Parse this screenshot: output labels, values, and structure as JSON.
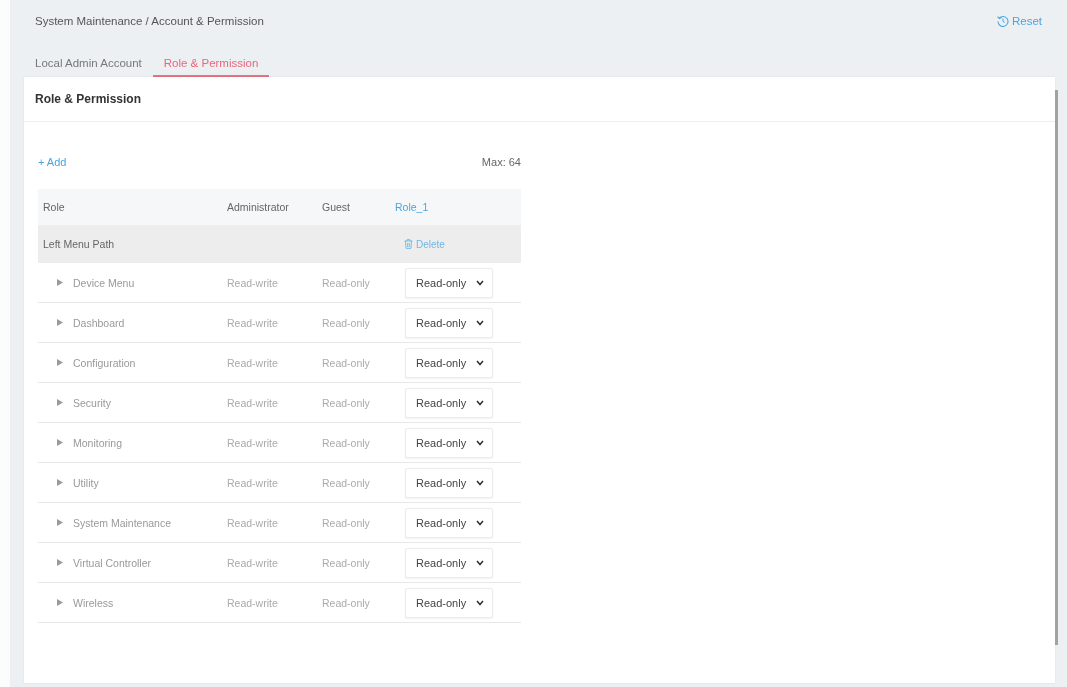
{
  "breadcrumb": "System Maintenance / Account & Permission",
  "reset_button": {
    "label": "Reset"
  },
  "tabs": [
    {
      "label": "Local Admin Account",
      "selected": false
    },
    {
      "label": "Role & Permission",
      "selected": true
    }
  ],
  "card": {
    "title": "Role & Permission",
    "add_button": "+ Add",
    "max_label": "Max: 64"
  },
  "table": {
    "columns": [
      {
        "label": "Role",
        "kind": "text"
      },
      {
        "label": "Administrator",
        "kind": "text"
      },
      {
        "label": "Guest",
        "kind": "text"
      },
      {
        "label": "Role_1",
        "kind": "link"
      }
    ],
    "section_row": {
      "label": "Left Menu Path",
      "delete_button": "Delete"
    },
    "rows": [
      {
        "label": "Device Menu",
        "expanded": false,
        "administrator": "Read-write",
        "guest": "Read-only",
        "role_1": "Read-only"
      },
      {
        "label": "Dashboard",
        "expanded": false,
        "administrator": "Read-write",
        "guest": "Read-only",
        "role_1": "Read-only"
      },
      {
        "label": "Configuration",
        "expanded": false,
        "administrator": "Read-write",
        "guest": "Read-only",
        "role_1": "Read-only"
      },
      {
        "label": "Security",
        "expanded": false,
        "administrator": "Read-write",
        "guest": "Read-only",
        "role_1": "Read-only"
      },
      {
        "label": "Monitoring",
        "expanded": false,
        "administrator": "Read-write",
        "guest": "Read-only",
        "role_1": "Read-only"
      },
      {
        "label": "Utility",
        "expanded": false,
        "administrator": "Read-write",
        "guest": "Read-only",
        "role_1": "Read-only"
      },
      {
        "label": "System Maintenance",
        "expanded": false,
        "administrator": "Read-write",
        "guest": "Read-only",
        "role_1": "Read-only"
      },
      {
        "label": "Virtual Controller",
        "expanded": false,
        "administrator": "Read-write",
        "guest": "Read-only",
        "role_1": "Read-only"
      },
      {
        "label": "Wireless",
        "expanded": false,
        "administrator": "Read-write",
        "guest": "Read-only",
        "role_1": "Read-only"
      }
    ]
  }
}
